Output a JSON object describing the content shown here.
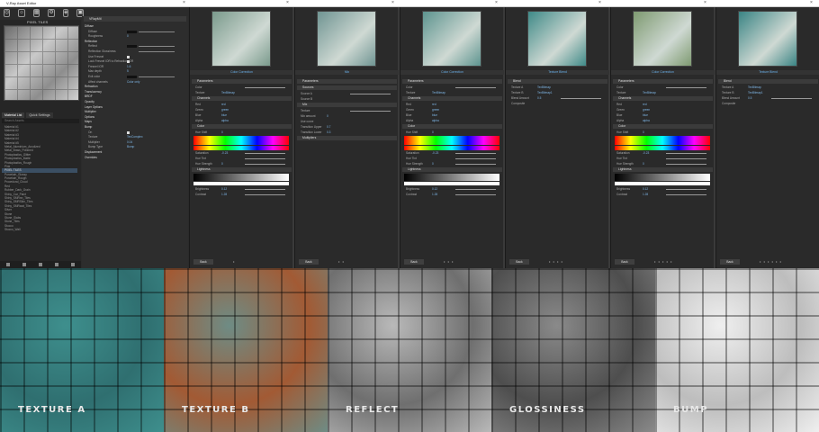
{
  "window": {
    "title": "V-Ray Asset Editor"
  },
  "toolbar": {
    "icons": [
      "material-icon",
      "light-icon",
      "texture-icon",
      "settings-icon",
      "render-icon",
      "crop-icon"
    ]
  },
  "left": {
    "preview_label": "PIXEL TILES",
    "tabs": [
      "Material List",
      "Quick Settings"
    ],
    "search_placeholder": "Search Assets",
    "items": [
      "Material #1",
      "Material #2",
      "Material #3",
      "Material #4",
      "Material #5",
      "Metal_Aluminium_Anodized",
      "Metal_Brass_Polished",
      "Photoplastics_Glitter",
      "Photoplastics_Matte",
      "Photoplastics_Rough",
      "Pink",
      "PIXEL TILES",
      "Porcelain_Glossy",
      "Porcelain_Rough",
      "Procedural_Cloud",
      "Red",
      "Rubber_Dark_Grain",
      "Shiny_Car_Paint",
      "Shiny_SMRnn_Tiles",
      "Shiny_SMRSkin_Tiles",
      "Shiny_SMRwat_Tiles",
      "Silver",
      "Stone",
      "Stone_Slabs",
      "Stone_Tiles",
      "Stucco",
      "Stucco_Wall"
    ],
    "selected_index": 11
  },
  "props": {
    "header": "VRayMtl",
    "rows": [
      {
        "label": "Diffuse",
        "type": "sec"
      },
      {
        "label": "Diffuse",
        "type": "color"
      },
      {
        "label": "Roughness",
        "type": "value",
        "value": "0"
      },
      {
        "label": "Reflection",
        "type": "sec"
      },
      {
        "label": "Reflect",
        "type": "color"
      },
      {
        "label": "Reflection Glossiness",
        "type": "slider"
      },
      {
        "label": "Use Fresnel",
        "type": "check"
      },
      {
        "label": "Lock Fresnel IOR to Refraction IOR",
        "type": "check"
      },
      {
        "label": "Fresnel IOR",
        "type": "value",
        "value": "1.6"
      },
      {
        "label": "Max depth",
        "type": "value",
        "value": "5"
      },
      {
        "label": "Exit color",
        "type": "color"
      },
      {
        "label": "Affect channels",
        "type": "value",
        "value": "Color only"
      },
      {
        "label": "Refraction",
        "type": "sec"
      },
      {
        "label": "Translucency",
        "type": "sec"
      },
      {
        "label": "BRDF",
        "type": "sec"
      },
      {
        "label": "Opacity",
        "type": "sec"
      },
      {
        "label": "Layer Options",
        "type": "sec"
      },
      {
        "label": "Multiplier",
        "type": "sec"
      },
      {
        "label": "Options",
        "type": "sec"
      },
      {
        "label": "Maps",
        "type": "sec"
      },
      {
        "label": "Bump",
        "type": "sec"
      },
      {
        "label": "On",
        "type": "check"
      },
      {
        "label": "Texture",
        "type": "value",
        "value": "TexComplex"
      },
      {
        "label": "Multiplier",
        "type": "value",
        "value": "0.04"
      },
      {
        "label": "Bump Type",
        "type": "value",
        "value": "Bump"
      },
      {
        "label": "Displacement",
        "type": "sec"
      },
      {
        "label": "Overrides",
        "type": "sec"
      }
    ]
  },
  "panels": [
    {
      "title": "Color Correction",
      "thumb": "#7a9a8c",
      "kind": "cc",
      "dots": "•"
    },
    {
      "title": "Mix",
      "thumb": "#6f9492",
      "kind": "mix",
      "dots": "• •"
    },
    {
      "title": "Color Correction",
      "thumb": "#5d948f",
      "kind": "cc",
      "dots": "• • •"
    },
    {
      "title": "Texture Blend",
      "thumb": "#3f8a88",
      "kind": "blend",
      "dots": "• • • •"
    },
    {
      "title": "Color Correction",
      "thumb": "#7e9a71",
      "kind": "cc",
      "dots": "• • • • •"
    },
    {
      "title": "Texture Blend",
      "thumb": "#3a8484",
      "kind": "blend",
      "dots": "• • • • • •"
    }
  ],
  "panel_text": {
    "parameters": "Parameters",
    "color": "Color",
    "texture": "Texture",
    "tex_value": "TexBitmap",
    "channels": "Channels",
    "red": "Red",
    "green": "Green",
    "blue": "Blue",
    "alpha": "Alpha",
    "red_v": "red",
    "green_v": "green",
    "blue_v": "blue",
    "alpha_v": "alpha",
    "color_sec": "Color",
    "hue_shift": "Hue Shift",
    "hue_v": "0",
    "saturation": "Saturation",
    "sat_v": "-0.23",
    "hue_tint": "Hue Tint",
    "hue_strength": "Hue Strength",
    "hs_v": "0",
    "lightness": "Lightness",
    "brightness": "Brightness",
    "bright_v": "0.12",
    "contrast": "Contrast",
    "contrast_v": "1.28",
    "sources": "Sources",
    "source_a": "Source A",
    "source_b": "Source B",
    "mix": "Mix",
    "mix_amount": "Mix amount",
    "mix_v": "0",
    "use_curve": "Use curve",
    "transition_upper": "Transition Upper",
    "tu_v": "0.7",
    "transition_lower": "Transition Lower",
    "tl_v": "0.3",
    "multipliers": "Multipliers",
    "blend": "Blend",
    "texture_a": "Texture A",
    "texture_b": "Texture B",
    "tb_value": "TexBitmap1",
    "blend_amount": "Blend Amount",
    "blend_v": "0.5",
    "composite": "Composite",
    "back": "Back"
  },
  "tiles": [
    {
      "label": "TEXTURE A",
      "bg": "#3e8f8d",
      "bg2": "#2f6f70"
    },
    {
      "label": "TEXTURE B",
      "bg": "#6e8c85",
      "bg2": "#a25a34"
    },
    {
      "label": "REFLECT",
      "bg": "#b9b9b9",
      "bg2": "#6f6f6f"
    },
    {
      "label": "GLOSSINESS",
      "bg": "#8a8a8a",
      "bg2": "#4e4e4e"
    },
    {
      "label": "BUMP",
      "bg": "#efefef",
      "bg2": "#bdbdbd"
    }
  ]
}
